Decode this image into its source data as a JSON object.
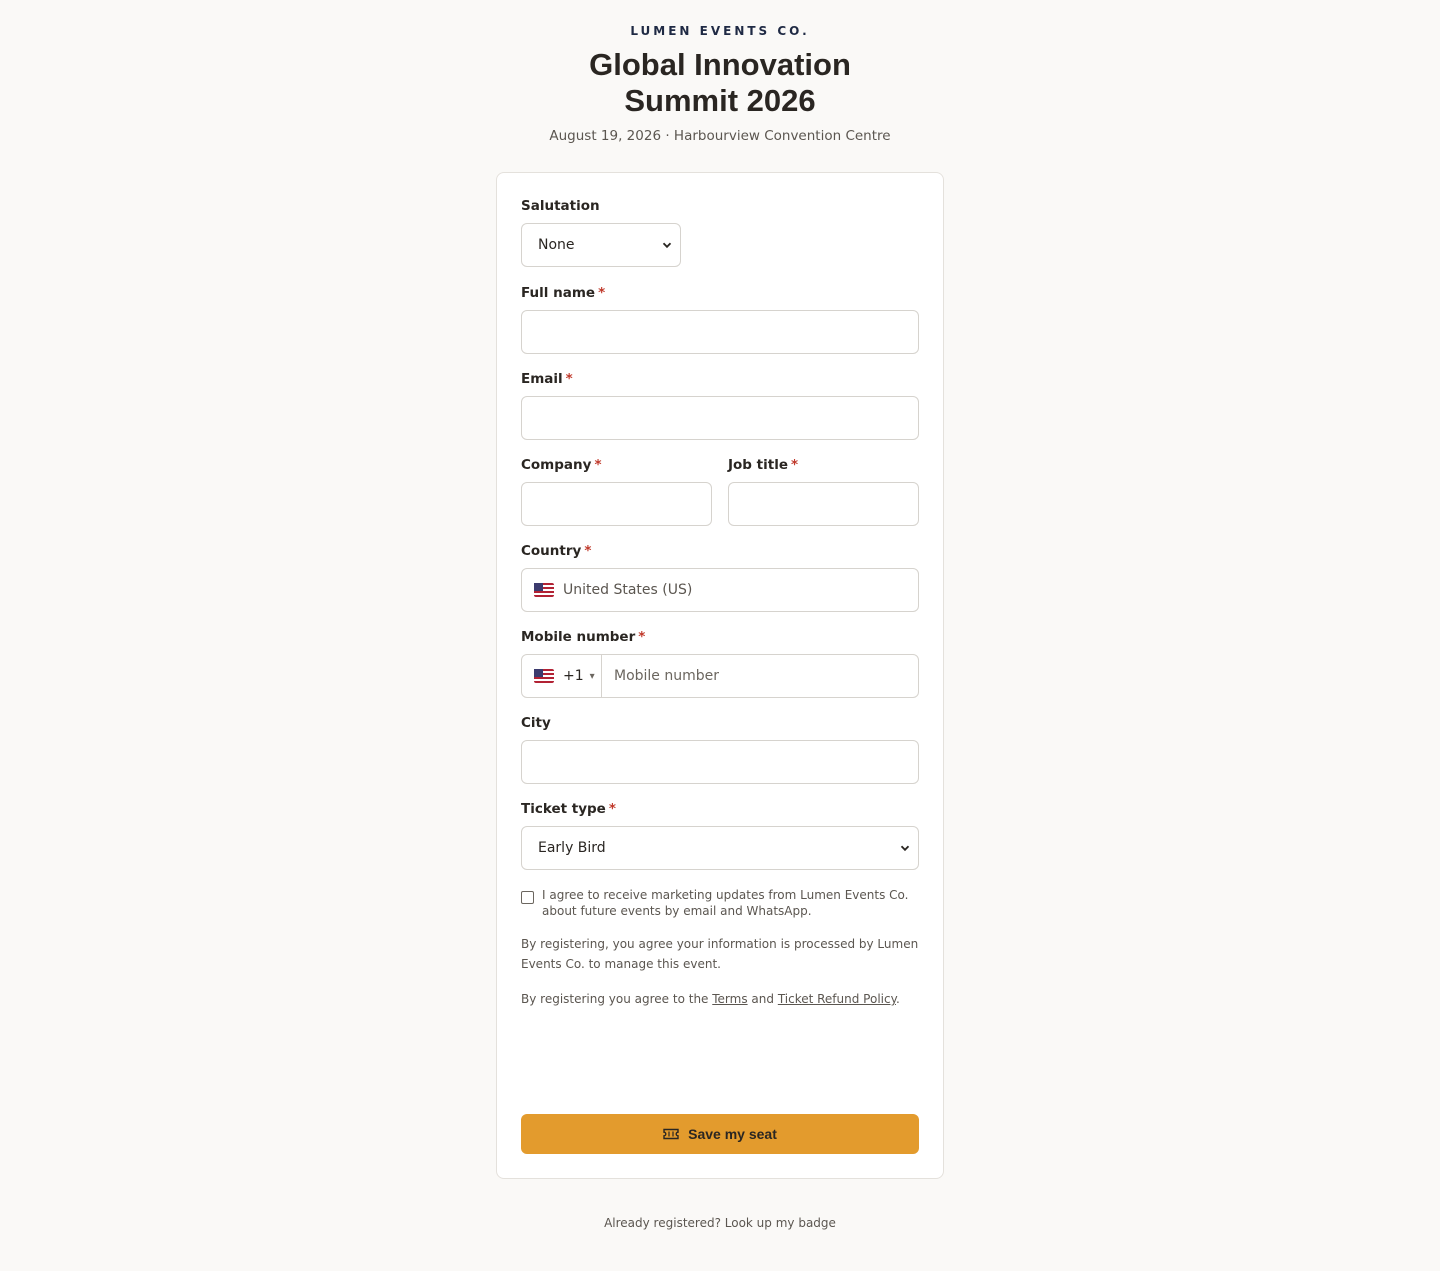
{
  "header": {
    "brand": "LUMEN EVENTS CO.",
    "title_line1": "Global Innovation",
    "title_line2": "Summit 2026",
    "subtitle": "August 19, 2026 · Harbourview Convention Centre"
  },
  "form": {
    "salutation": {
      "label": "Salutation",
      "value": "None"
    },
    "full_name": {
      "label": "Full name",
      "required": "*",
      "value": ""
    },
    "email": {
      "label": "Email",
      "required": "*",
      "value": ""
    },
    "company": {
      "label": "Company",
      "required": "*",
      "value": ""
    },
    "job_title": {
      "label": "Job title",
      "required": "*",
      "value": ""
    },
    "country": {
      "label": "Country",
      "required": "*",
      "value": "United States (US)",
      "flag": "us-flag-icon"
    },
    "mobile": {
      "label": "Mobile number",
      "required": "*",
      "dial_code": "+1",
      "caret": "▾",
      "placeholder": "Mobile number",
      "value": ""
    },
    "city": {
      "label": "City",
      "value": ""
    },
    "ticket_type": {
      "label": "Ticket type",
      "required": "*",
      "value": "Early Bird"
    },
    "marketing_consent": {
      "checked": false,
      "text": "I agree to receive marketing updates from Lumen Events Co. about future events by email and WhatsApp."
    },
    "privacy_note": "By registering, you agree your information is processed by Lumen Events Co. to manage this event.",
    "terms_note": {
      "prefix": "By registering you agree to the ",
      "terms_link": "Terms",
      "and": " and ",
      "refund_link": "Ticket Refund Policy",
      "suffix": "."
    },
    "submit": {
      "label": "Save my seat",
      "icon": "ticket-icon"
    }
  },
  "footer": {
    "text": "Already registered? Look up my badge"
  },
  "colors": {
    "background": "#faf9f7",
    "accent": "#e39b2d",
    "required": "#c0392b",
    "brand": "#1f2a44"
  }
}
